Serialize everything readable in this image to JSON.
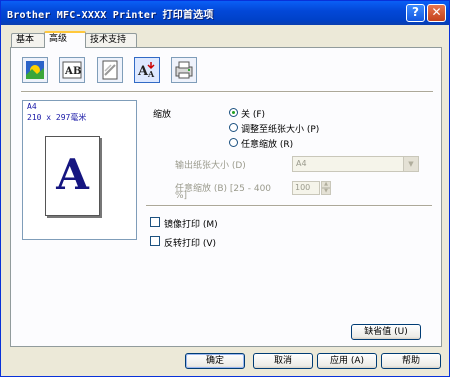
{
  "window": {
    "title": "Brother MFC-XXXX Printer 打印首选项"
  },
  "titlebar_buttons": {
    "help": "?",
    "close": "✕"
  },
  "tabs": [
    {
      "label": "基本",
      "active": false
    },
    {
      "label": "高级",
      "active": true
    },
    {
      "label": "技术支持",
      "active": false
    }
  ],
  "toolbar": {
    "icons": [
      "color-quality-icon",
      "text-layout-icon",
      "watermark-icon",
      "scaling-icon",
      "device-options-icon"
    ],
    "selected_icon": "scaling-icon"
  },
  "preview": {
    "paper_name": "A4",
    "paper_size": "210 x 297毫米",
    "letter": "A"
  },
  "scaling": {
    "label": "缩放",
    "options": [
      {
        "label": "关 (F)",
        "selected": true
      },
      {
        "label": "调整至纸张大小 (P)",
        "selected": false
      },
      {
        "label": "任意缩放 (R)",
        "selected": false
      }
    ],
    "output_paper_label": "输出纸张大小 (D)",
    "output_paper_value": "A4",
    "free_scale_label_line1": "任意缩放 (B) [25 - 400",
    "free_scale_label_line2": "%]",
    "free_scale_value": "100"
  },
  "mirror_print": {
    "label": "镜像打印 (M)",
    "checked": false
  },
  "reverse_print": {
    "label": "反转打印 (V)",
    "checked": false
  },
  "default_button": "缺省值 (U)",
  "footer": {
    "ok": "确定",
    "cancel": "取消",
    "apply": "应用 (A)",
    "help": "帮助"
  }
}
